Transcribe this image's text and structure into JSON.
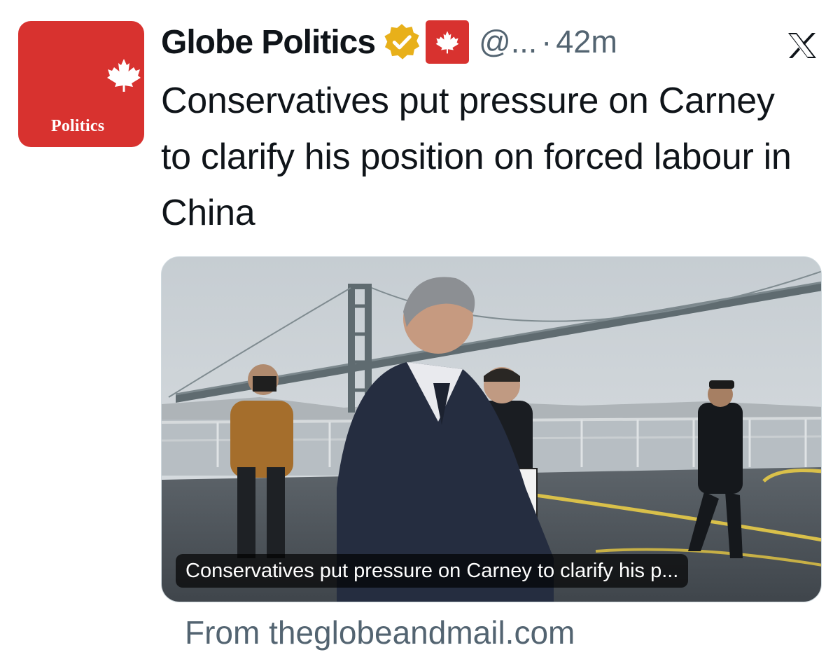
{
  "avatar": {
    "label": "Politics",
    "bg_color": "#d8322f",
    "icon": "maple-leaf-icon"
  },
  "account": {
    "name": "Globe Politics",
    "handle": "@...",
    "separator": "·",
    "time": "42m",
    "verified_badge": "gold-check-icon",
    "affiliate_badge": "maple-leaf-flag-icon"
  },
  "platform_logo": "x-logo-icon",
  "post": {
    "headline": "Conservatives put pressure on Carney to clarify his position on forced labour in China"
  },
  "link_card": {
    "caption": "Conservatives put pressure on Carney to clarify his p...",
    "source": "From theglobeandmail.com"
  },
  "colors": {
    "brand_red": "#d8322f",
    "secondary_text": "#536471",
    "verified_gold": "#e8b01a"
  }
}
